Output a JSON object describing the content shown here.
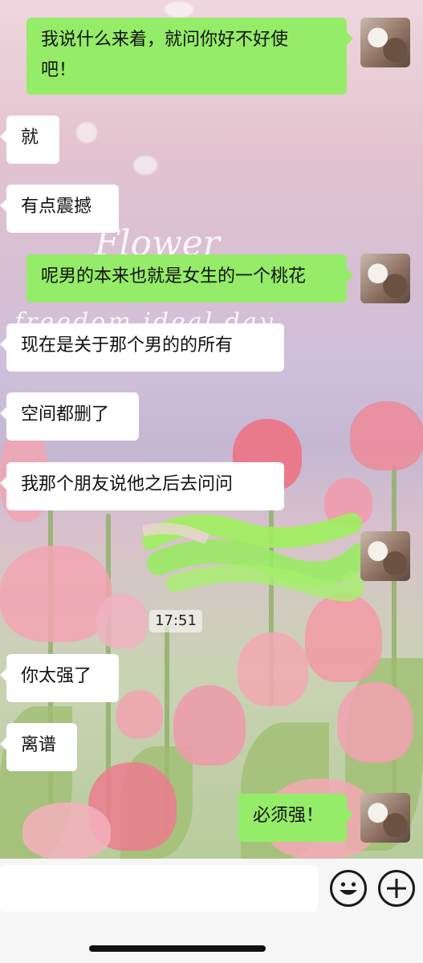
{
  "messages": [
    {
      "side": "right",
      "text": "我说什么来着，就问你好不好使吧！"
    },
    {
      "side": "left",
      "text": "就"
    },
    {
      "side": "left",
      "text": "有点震撼"
    },
    {
      "side": "right",
      "text": "呢男的本来也就是女生的一个桃花"
    },
    {
      "side": "left",
      "text": "现在是关于那个男的的所有"
    },
    {
      "side": "left",
      "text": "空间都删了"
    },
    {
      "side": "left",
      "text": "我那个朋友说他之后去问问"
    },
    {
      "side": "right",
      "text": "",
      "redacted": true
    },
    {
      "side": "left",
      "text": "你太强了"
    },
    {
      "side": "left",
      "text": "离谱"
    },
    {
      "side": "right",
      "text": "必须强！"
    }
  ],
  "timestamp": "17:51",
  "chat": {
    "line1a": "我说什么来着，就问你好不好使",
    "line1b": "吧！"
  },
  "wallpaper": {
    "script_text_1": "Flower",
    "script_text_2": "freedom ideal day"
  },
  "icons": {
    "emoji": "smiley-face-icon",
    "more": "plus-icon"
  },
  "colors": {
    "sent_bubble": "#95ec69",
    "received_bubble": "#ffffff",
    "input_bar": "#f6f6f6"
  }
}
